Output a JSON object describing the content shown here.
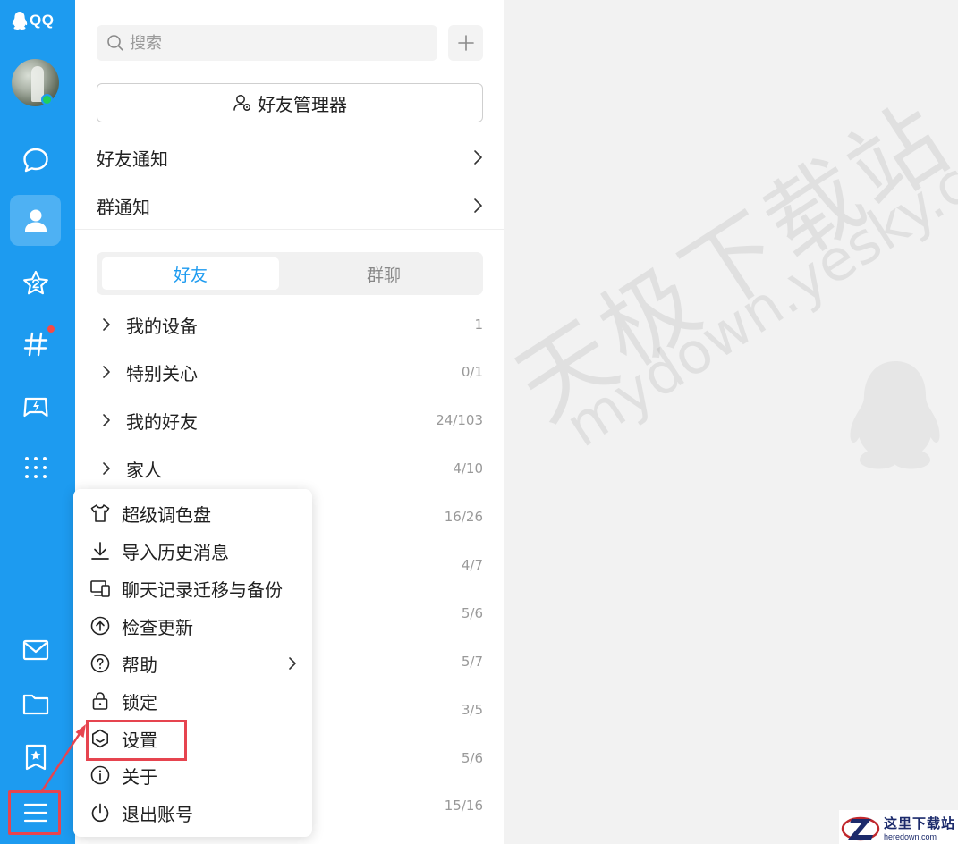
{
  "app": {
    "logo_text": "QQ"
  },
  "colors": {
    "brand": "#1d9bf0",
    "online": "#1fd05c",
    "badge": "#f54a45",
    "annotation": "#e6444f"
  },
  "rail": {
    "items": [
      {
        "name": "messages",
        "icon": "chat-bubble-icon"
      },
      {
        "name": "contacts",
        "icon": "contacts-person-icon",
        "active": true
      },
      {
        "name": "favorites",
        "icon": "star-icon"
      },
      {
        "name": "channels",
        "icon": "hash-icon",
        "badge": true
      },
      {
        "name": "games",
        "icon": "game-icon"
      },
      {
        "name": "apps",
        "icon": "grid-dots-icon"
      },
      {
        "name": "mail",
        "icon": "mail-icon"
      },
      {
        "name": "files",
        "icon": "folder-icon"
      },
      {
        "name": "bookmarks",
        "icon": "bookmark-star-icon"
      },
      {
        "name": "main-menu",
        "icon": "hamburger-menu-icon"
      }
    ]
  },
  "contacts": {
    "search_placeholder": "搜索",
    "friend_manager_label": "好友管理器",
    "friend_notice_label": "好友通知",
    "group_notice_label": "群通知",
    "tabs": [
      {
        "label": "好友",
        "active": true
      },
      {
        "label": "群聊",
        "active": false
      }
    ],
    "groups": [
      {
        "name": "我的设备",
        "count": "1"
      },
      {
        "name": "特别关心",
        "count": "0/1"
      },
      {
        "name": "我的好友",
        "count": "24/103"
      },
      {
        "name": "家人",
        "count": "4/10"
      }
    ],
    "hidden_counts": [
      "16/26",
      "4/7",
      "5/6",
      "5/7",
      "3/5",
      "5/6",
      "15/16"
    ]
  },
  "menu": {
    "items": [
      {
        "label": "超级调色盘",
        "icon": "shirt-icon"
      },
      {
        "label": "导入历史消息",
        "icon": "download-icon"
      },
      {
        "label": "聊天记录迁移与备份",
        "icon": "device-transfer-icon"
      },
      {
        "label": "检查更新",
        "icon": "upload-circle-icon"
      },
      {
        "label": "帮助",
        "icon": "help-circle-icon",
        "submenu": true
      },
      {
        "label": "锁定",
        "icon": "lock-icon"
      },
      {
        "label": "设置",
        "icon": "hexagon-settings-icon",
        "highlighted": true
      },
      {
        "label": "关于",
        "icon": "info-circle-icon"
      },
      {
        "label": "退出账号",
        "icon": "power-icon"
      }
    ]
  },
  "watermark": {
    "line1": "天极下载站",
    "line2": "mydown.yesky.com"
  },
  "corner_logo": {
    "cn": "这里下载站",
    "en": "heredown.com"
  }
}
